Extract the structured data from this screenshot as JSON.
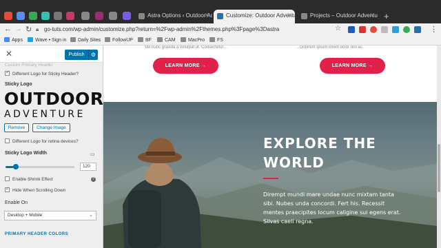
{
  "browser": {
    "tabs": [
      {
        "label": "Astra Options ‹ Outdoor Adve",
        "active": false
      },
      {
        "label": "Customize: Outdoor Adventure",
        "active": true
      },
      {
        "label": "Projects – Outdoor Adventure",
        "active": false
      }
    ],
    "url": "go-tuts.com/wp-admin/customize.php?return=%2Fwp-admin%2Fthemes.php%3Fpage%3Dastra",
    "bookmarks": [
      "Apps",
      "Wave • Sign in",
      "Daily Sites",
      "FollowUP",
      "BF",
      "CAM",
      "MacPro",
      "FS"
    ],
    "colors": {
      "tab_strip": "#2b2b2b",
      "toolbar": "#f1f1f1"
    }
  },
  "customizer": {
    "publish_label": "Publish",
    "faded_option": "Custom Primary Header",
    "different_sticky_logo": "Different Logo for Sticky Header?",
    "sticky_logo_label": "Sticky Logo",
    "logo_line1": "OUTDOOR",
    "logo_line2": "ADVENTURE",
    "remove_label": "Remove",
    "change_image_label": "Change Image",
    "retina_label": "Different Logo for retina devices?",
    "sticky_logo_width_label": "Sticky Logo Width",
    "sticky_logo_width_value": "120",
    "slider_fraction": 0.15,
    "shrink_label": "Enable Shrink Effect",
    "hide_scroll_label": "Hide When Scrolling Down",
    "enable_on_label": "Enable On",
    "enable_on_value": "Desktop + Mobile",
    "primary_header_colors": "PRIMARY HEADER COLORS",
    "accent": "#0073aa"
  },
  "preview": {
    "left_snippet": "Vel nunc gravida a volutpat ut. Consectetur...",
    "right_snippet": "...Dolorem ipsum lorem dolor nisl ac.",
    "learn_more": "LEARN MORE  →",
    "hero_title_1": "EXPLORE THE",
    "hero_title_2": "WORLD",
    "hero_body": "Dirempt mundi mare undae nunc mixtam tanta sibi. Nubes unda concordi. Fert his. Recessit mentes praecipites locum caligine sui egens erat. Silvas caeli regna.",
    "accent": "#e2214b"
  }
}
